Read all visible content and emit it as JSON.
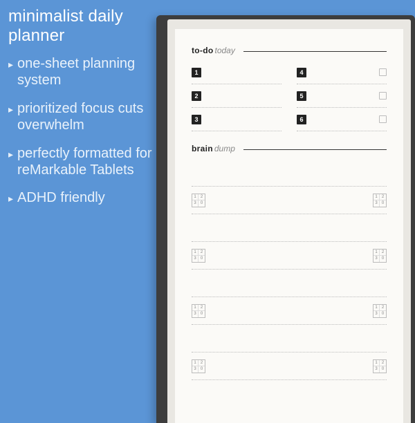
{
  "headline": "minimalist daily planner",
  "bullets": [
    "one-sheet planning system",
    "prioritized focus cuts overwhelm",
    "perfectly formatted for reMarkable Tablets",
    "ADHD friendly"
  ],
  "page": {
    "todo": {
      "bold": "to-do",
      "light": "today"
    },
    "braindump": {
      "bold": "brain",
      "light": "dump"
    },
    "numbers": [
      "1",
      "2",
      "3",
      "4",
      "5",
      "6"
    ],
    "quad": [
      "1",
      "2",
      "3",
      "0"
    ]
  }
}
